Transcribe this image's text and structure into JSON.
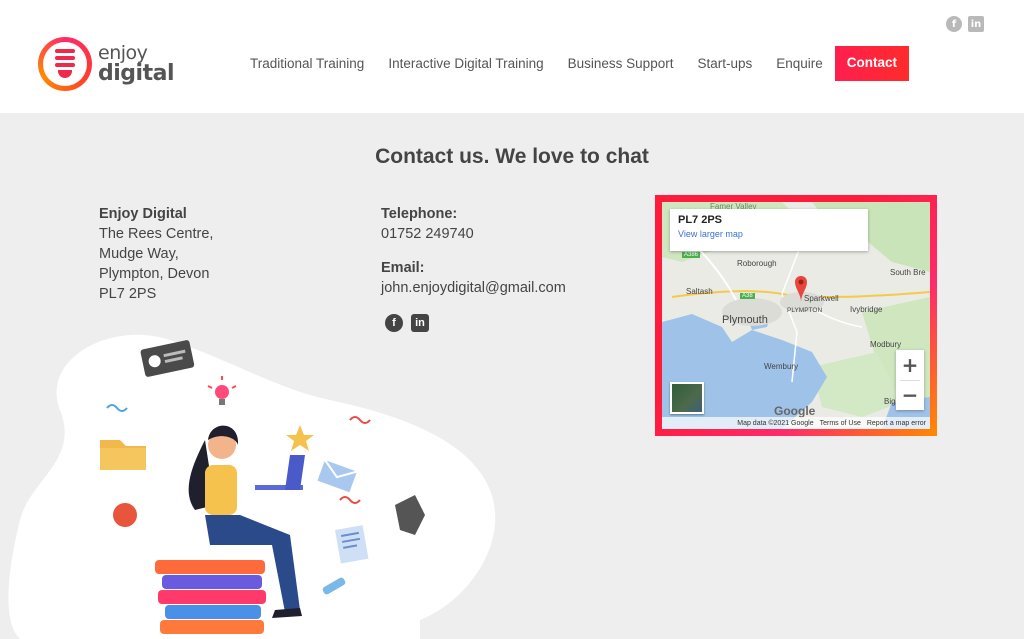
{
  "header": {
    "logo": {
      "line1": "enjoy",
      "line2": "digital"
    },
    "social": [
      "facebook-icon",
      "linkedin-icon"
    ],
    "nav": [
      {
        "label": "Traditional Training"
      },
      {
        "label": "Interactive Digital Training"
      },
      {
        "label": "Business Support"
      },
      {
        "label": "Start-ups"
      },
      {
        "label": "Enquire"
      },
      {
        "label": "Contact"
      }
    ],
    "accent": "#ff1f4f"
  },
  "main": {
    "headline_bold": "Contact us.",
    "headline_rest": " We love to chat",
    "address": {
      "company": "Enjoy Digital",
      "line1": "The Rees Centre,",
      "line2": "Mudge Way,",
      "line3": "Plympton, Devon",
      "line4": "PL7 2PS"
    },
    "contact": {
      "telephone_label": "Telephone:",
      "telephone": "01752 249740",
      "email_label": "Email:",
      "email": "john.enjoydigital@gmail.com"
    }
  },
  "map": {
    "place": "PL7 2PS",
    "larger_link": "View larger map",
    "labels": {
      "farmer_valley": "Famer Valley",
      "roborough": "Roborough",
      "south_brent": "South Bre",
      "saltash": "Saltash",
      "sparkwell": "Sparkwell",
      "plympton": "PLYMPTON",
      "ivybridge": "Ivybridge",
      "plymouth": "Plymouth",
      "modbury": "Modbury",
      "wembury": "Wembury",
      "bigbury": "Bigbury-o"
    },
    "road_a38": "A38",
    "road_a386": "A386",
    "zoom_in": "+",
    "zoom_out": "−",
    "google": "Google",
    "footer": [
      "Map data ©2021 Google",
      "Terms of Use",
      "Report a map error"
    ]
  }
}
